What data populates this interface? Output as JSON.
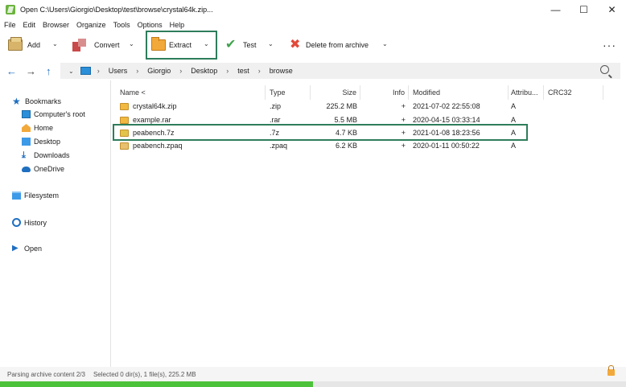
{
  "window": {
    "title": "Open C:\\Users\\Giorgio\\Desktop\\test\\browse\\crystal64k.zip...",
    "minimize": "—",
    "maximize": "☐",
    "close": "✕"
  },
  "menu": [
    "File",
    "Edit",
    "Browser",
    "Organize",
    "Tools",
    "Options",
    "Help"
  ],
  "toolbar": {
    "add": "Add",
    "convert": "Convert",
    "extract": "Extract",
    "test": "Test",
    "delete": "Delete from archive",
    "caret": "⌄",
    "more": "···"
  },
  "address": {
    "back": "←",
    "forward": "→",
    "up": "↑",
    "crumbs": [
      "Users",
      "Giorgio",
      "Desktop",
      "test",
      "browse"
    ],
    "sep": "›"
  },
  "sidebar": {
    "bookmarks": "Bookmarks",
    "items": [
      "Computer's root",
      "Home",
      "Desktop",
      "Downloads",
      "OneDrive"
    ],
    "filesystem": "Filesystem",
    "history": "History",
    "open": "Open"
  },
  "columns": {
    "name": "Name <",
    "type": "Type",
    "size": "Size",
    "info": "Info",
    "modified": "Modified",
    "attributes": "Attribu...",
    "crc": "CRC32"
  },
  "files": [
    {
      "name": "crystal64k.zip",
      "type": ".zip",
      "size": "225.2 MB",
      "info": "+",
      "modified": "2021-07-02 22:55:08",
      "attr": "A"
    },
    {
      "name": "example.rar",
      "type": ".rar",
      "size": "5.5 MB",
      "info": "+",
      "modified": "2020-04-15 03:33:14",
      "attr": "A"
    },
    {
      "name": "peabench.7z",
      "type": ".7z",
      "size": "4.7 KB",
      "info": "+",
      "modified": "2021-01-08 18:23:56",
      "attr": "A"
    },
    {
      "name": "peabench.zpaq",
      "type": ".zpaq",
      "size": "6.2 KB",
      "info": "+",
      "modified": "2020-01-11 00:50:22",
      "attr": "A"
    }
  ],
  "status": {
    "parsing": "Parsing archive content 2/3",
    "selection": "Selected 0 dir(s), 1 file(s), 225.2 MB",
    "progress": 0.5
  }
}
